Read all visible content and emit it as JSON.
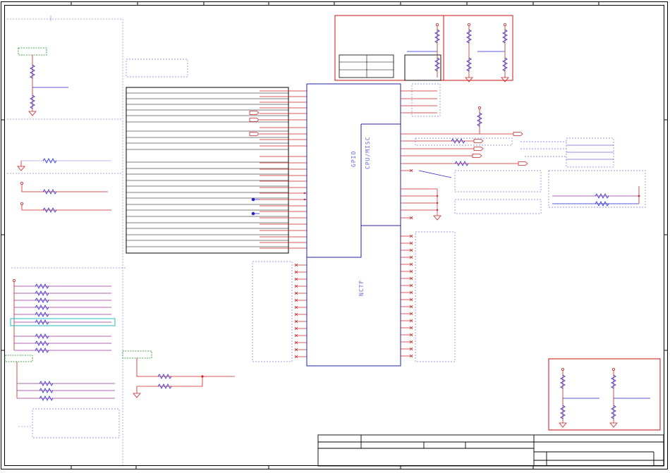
{
  "blocks": {
    "gpio_label": "GPIO",
    "cpu_misc_label": "CPU/MISC",
    "nctf_label": "NCTF"
  },
  "colors": {
    "frame": "#000000",
    "wire_red": "#cc2222",
    "wire_blue": "#2222cc",
    "dash_blue": "#7777dd",
    "box_red": "#cc1111",
    "net_green": "#118811",
    "highlight_cyan": "#22bbcc",
    "net_purple": "#993399"
  },
  "icons": [
    "resistor-symbol",
    "ground-symbol",
    "power-symbol",
    "off-page-connector",
    "no-connect-mark",
    "junction-dot"
  ]
}
